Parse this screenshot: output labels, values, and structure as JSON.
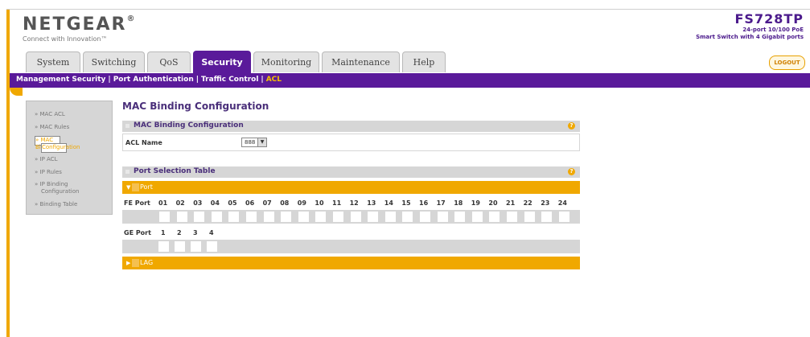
{
  "header": {
    "brand": "NETGEAR",
    "brand_mark": "®",
    "tagline": "Connect with Innovation™",
    "model": "FS728TP",
    "model_desc_1": "24-port 10/100 PoE",
    "model_desc_2": "Smart Switch with 4 Gigabit ports",
    "logout": "LOGOUT"
  },
  "tabs": [
    "System",
    "Switching",
    "QoS",
    "Security",
    "Monitoring",
    "Maintenance",
    "Help"
  ],
  "active_tab": "Security",
  "subnav": [
    "Management Security",
    "Port Authentication",
    "Traffic Control",
    "ACL"
  ],
  "sidebar": [
    "» MAC ACL",
    "» MAC Rules",
    "» MAC Binding",
    "Configuration",
    "» IP ACL",
    "» IP Rules",
    "» IP Binding",
    "Configuration",
    "» Binding Table"
  ],
  "page_title": "MAC Binding Configuration",
  "mac_section": {
    "title": "MAC Binding Configuration",
    "acl_label": "ACL Name",
    "acl_value": "888"
  },
  "port_section": {
    "title": "Port Selection Table",
    "port_bar": "Port",
    "fe_label": "FE Port",
    "fe_ports": [
      "01",
      "02",
      "03",
      "04",
      "05",
      "06",
      "07",
      "08",
      "09",
      "10",
      "11",
      "12",
      "13",
      "14",
      "15",
      "16",
      "17",
      "18",
      "19",
      "20",
      "21",
      "22",
      "23",
      "24"
    ],
    "ge_label": "GE Port",
    "ge_ports": [
      "1",
      "2",
      "3",
      "4"
    ],
    "lag_bar": "LAG"
  },
  "help_glyph": "?",
  "colors": {
    "purple": "#5a1a9a",
    "orange": "#f0a800",
    "gray": "#d6d6d6"
  }
}
